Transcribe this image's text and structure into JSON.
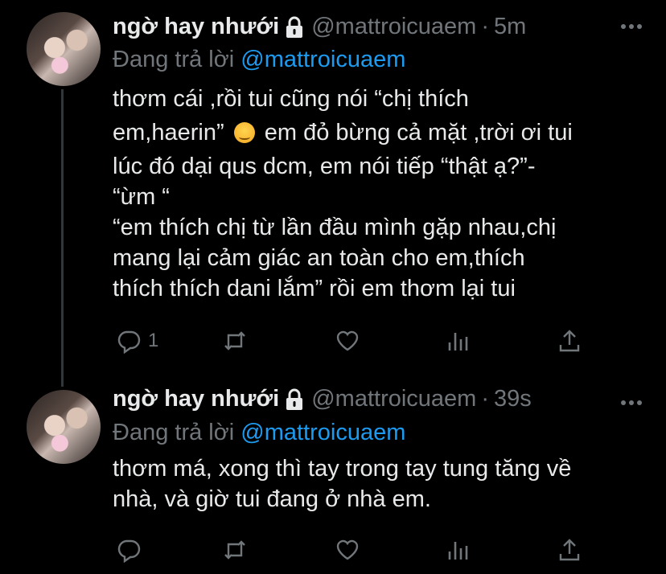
{
  "tweets": [
    {
      "display_name": "ngờ hay nhưới",
      "handle": "@mattroicuaem",
      "separator": "·",
      "time": "5m",
      "replying_label": "Đang trả lời",
      "replying_handle": "@mattroicuaem",
      "lines": [
        "thơm cái ,rồi tui cũng nói “chị thích",
        "em,haerin”",
        "em đỏ bừng cả mặt ,trời ơi tui",
        "lúc đó dại qus dcm, em nói tiếp “thật ạ?”-",
        "“ừm “",
        "“em thích chị từ lần đầu mình gặp nhau,chị",
        "mang lại cảm giác an toàn cho em,thích",
        "thích thích dani lắm” rồi em thơm lại tui"
      ],
      "reply_count": "1"
    },
    {
      "display_name": "ngờ hay nhưới",
      "handle": "@mattroicuaem",
      "separator": "·",
      "time": "39s",
      "replying_label": "Đang trả lời",
      "replying_handle": "@mattroicuaem",
      "lines": [
        "thơm má, xong thì tay trong tay tung tăng về",
        "nhà, và giờ tui đang ở nhà em."
      ],
      "reply_count": ""
    }
  ],
  "icons": {
    "lock": "lock-icon",
    "more": "more-icon",
    "reply": "reply-icon",
    "retweet": "retweet-icon",
    "like": "heart-icon",
    "views": "analytics-icon",
    "share": "share-icon",
    "emoji": "smirking-face-emoji"
  },
  "colors": {
    "background": "#000000",
    "text": "#e7e9ea",
    "muted": "#71767b",
    "link": "#1d9bf0"
  }
}
